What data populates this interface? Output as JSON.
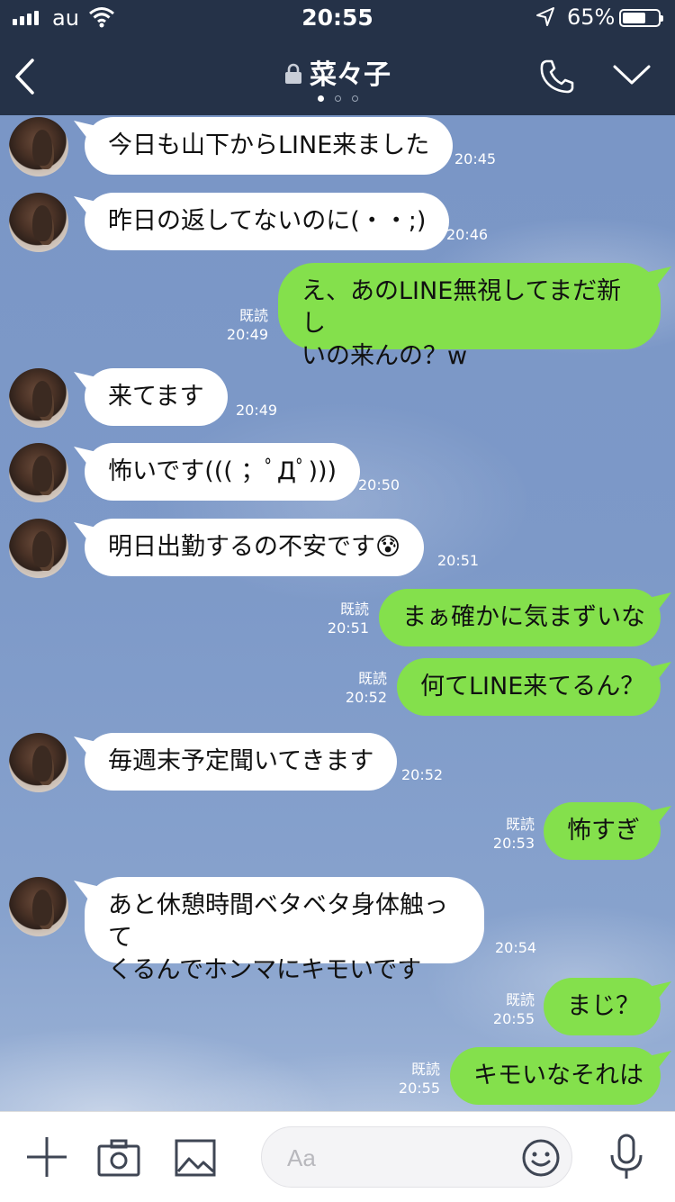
{
  "status_bar": {
    "carrier": "au",
    "time": "20:55",
    "battery_pct": "65%",
    "battery_level": 0.65
  },
  "header": {
    "title": "菜々子",
    "page_dots": 3,
    "active_dot": 1
  },
  "colors": {
    "header_bg": "#253248",
    "outgoing_bubble": "#84e04c",
    "incoming_bubble": "#ffffff"
  },
  "messages": [
    {
      "dir": "in",
      "text": "今日も山下からLINE来ました",
      "time": "20:45"
    },
    {
      "dir": "in",
      "text": "昨日の返してないのに(・・;)",
      "time": "20:46"
    },
    {
      "dir": "out",
      "lines": [
        "え、あのLINE無視してまだ新し",
        "いの来んの？w"
      ],
      "read": "既読",
      "time": "20:49"
    },
    {
      "dir": "in",
      "text": "来てます",
      "time": "20:49"
    },
    {
      "dir": "in",
      "text": "怖いです((( ；ﾟДﾟ)))",
      "time": "20:50"
    },
    {
      "dir": "in",
      "text": "明日出勤するの不安です😰",
      "time": "20:51"
    },
    {
      "dir": "out",
      "text": "まぁ確かに気まずいな",
      "read": "既読",
      "time": "20:51"
    },
    {
      "dir": "out",
      "text": "何てLINE来てるん？",
      "read": "既読",
      "time": "20:52"
    },
    {
      "dir": "in",
      "text": "毎週末予定聞いてきます",
      "time": "20:52"
    },
    {
      "dir": "out",
      "text": "怖すぎ",
      "read": "既読",
      "time": "20:53"
    },
    {
      "dir": "in",
      "lines": [
        "あと休憩時間ベタベタ身体触って",
        "くるんでホンマにキモいです"
      ],
      "time": "20:54"
    },
    {
      "dir": "out",
      "text": "まじ？",
      "read": "既読",
      "time": "20:55"
    },
    {
      "dir": "out",
      "text": "キモいなそれは",
      "read": "既読",
      "time": "20:55"
    }
  ],
  "input": {
    "placeholder": "Aa"
  },
  "icons": {
    "back": "back-arrow-icon",
    "lock": "lock-icon",
    "call": "phone-icon",
    "menu": "chevron-down-icon",
    "plus": "plus-icon",
    "camera": "camera-icon",
    "image": "image-icon",
    "emoji": "smiley-icon",
    "voice": "microphone-icon"
  }
}
